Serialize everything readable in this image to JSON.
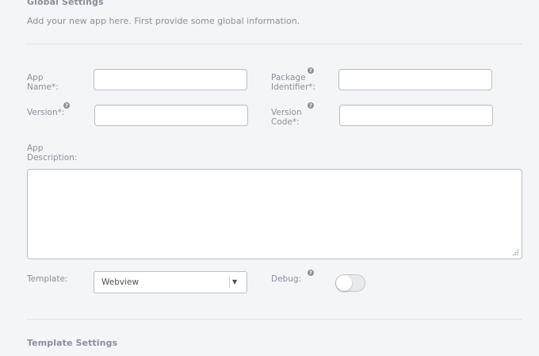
{
  "global_settings": {
    "title": "Global Settings",
    "intro": "Add your new app here. First provide some global information."
  },
  "fields": {
    "app_name_label": "App Name*:",
    "package_identifier_label": "Package Identifier*:",
    "version_label": "Version*:",
    "version_code_label": "Version Code*:",
    "app_description_label": "App Description:",
    "template_label": "Template:",
    "debug_label": "Debug:",
    "help_glyph": "?"
  },
  "template_select": {
    "value": "Webview",
    "arrow": "▼"
  },
  "debug_toggle": {
    "on": false
  },
  "template_settings": {
    "title": "Template Settings"
  }
}
